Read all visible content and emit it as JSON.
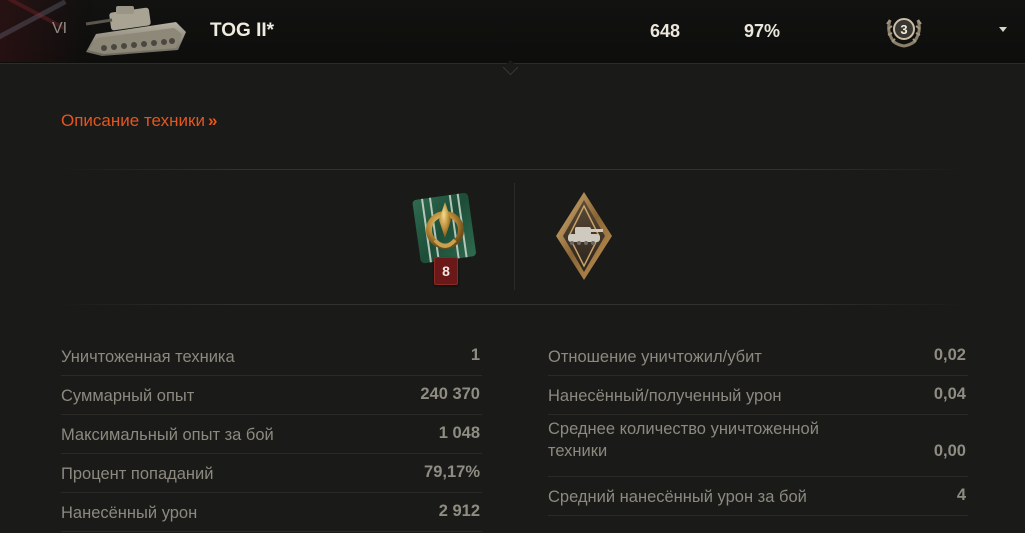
{
  "vehicle": {
    "tier": "VI",
    "name": "TOG II*",
    "battles": "648",
    "win_rate": "97%",
    "mastery_level": "3",
    "nation_flag": "united-kingdom-flag",
    "thumbnail": "tog-ii-tank-thumbnail"
  },
  "description_link": {
    "label": "Описание техники",
    "arrow": "»",
    "color": "#e3561f"
  },
  "awards": [
    {
      "icon": "green-ribbon-medal-icon",
      "count": "8"
    },
    {
      "icon": "diamond-tank-badge-icon"
    }
  ],
  "stats_left": [
    {
      "label": "Уничтоженная техника",
      "value": "1"
    },
    {
      "label": "Суммарный опыт",
      "value": "240 370"
    },
    {
      "label": "Максимальный опыт за бой",
      "value": "1 048"
    },
    {
      "label": "Процент попаданий",
      "value": "79,17%"
    },
    {
      "label": "Нанесённый урон",
      "value": "2 912"
    }
  ],
  "stats_right": [
    {
      "label": "Отношение уничтожил/убит",
      "value": "0,02"
    },
    {
      "label": "Нанесённый/полученный урон",
      "value": "0,04"
    },
    {
      "label": "Среднее количество уничтоженной техники",
      "value": "0,00"
    },
    {
      "label": "Средний нанесённый урон за бой",
      "value": "4"
    }
  ]
}
